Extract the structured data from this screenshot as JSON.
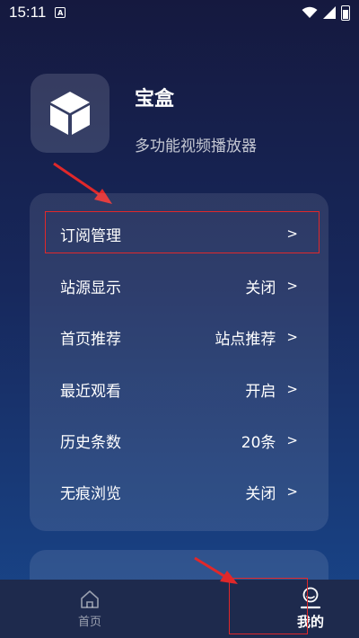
{
  "status_bar": {
    "time": "15:11",
    "notification_badge": "A"
  },
  "app": {
    "name": "宝盒",
    "subtitle": "多功能视频播放器",
    "logo_icon": "cube-icon"
  },
  "settings": [
    {
      "label": "订阅管理",
      "value": "",
      "arrow": ">"
    },
    {
      "label": "站源显示",
      "value": "关闭",
      "arrow": ">"
    },
    {
      "label": "首页推荐",
      "value": "站点推荐",
      "arrow": ">"
    },
    {
      "label": "最近观看",
      "value": "开启",
      "arrow": ">"
    },
    {
      "label": "历史条数",
      "value": "20条",
      "arrow": ">"
    },
    {
      "label": "无痕浏览",
      "value": "关闭",
      "arrow": ">"
    }
  ],
  "bottom_nav": {
    "home_label": "首页",
    "mine_label": "我的",
    "active": "mine"
  },
  "colors": {
    "annotation_red": "#e0282a",
    "background_top": "#15193f",
    "background_bottom": "#19478c"
  }
}
